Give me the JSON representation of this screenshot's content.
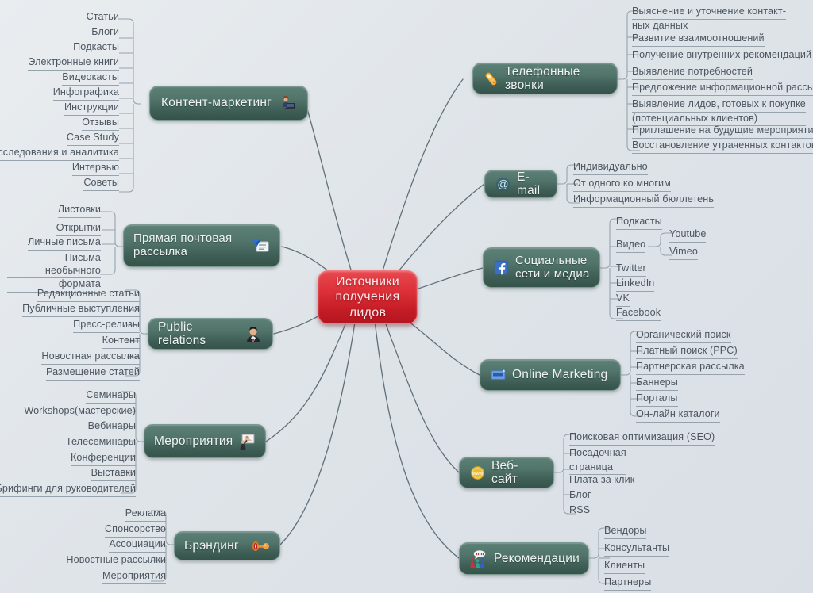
{
  "map": {
    "center": {
      "label": "Источники\nполучения\nлидов",
      "color": "#c81c26"
    },
    "node_color": "#4a6d63",
    "branches": [
      {
        "id": "content-marketing",
        "label": "Контент-маркетинг",
        "icon": "person-laptop-icon",
        "side": "left",
        "children": [
          "Статьи",
          "Блоги",
          "Подкасты",
          "Электронные книги",
          "Видеокасты",
          "Инфографика",
          "Инструкции",
          "Отзывы",
          "Case Study",
          "Исследования и аналитика",
          "Интервью",
          "Советы"
        ]
      },
      {
        "id": "direct-mail",
        "label": "Прямая почтовая\nрассылка",
        "icon": "envelope-letter-icon",
        "side": "left",
        "children": [
          "Листовки",
          "Открытки",
          "Личные письма",
          "Письма необычного формата"
        ]
      },
      {
        "id": "public-relations",
        "label": "Public relations",
        "icon": "businessman-icon",
        "side": "left",
        "children": [
          "Редакционные статьи",
          "Публичные выступления",
          "Пресс-релизы",
          "Контент",
          "Новостная рассылка",
          "Размещение статей"
        ]
      },
      {
        "id": "events",
        "label": "Мероприятия",
        "icon": "presenter-board-icon",
        "side": "left",
        "children": [
          "Семинары",
          "Workshops(мастерские)",
          "Вебинары",
          "Телесеминары",
          "Конференции",
          "Выставки",
          "Брифинги для руководителей"
        ]
      },
      {
        "id": "branding",
        "label": "Брэндинг",
        "icon": "rubber-stamp-icon",
        "side": "left",
        "children": [
          "Реклама",
          "Спонсорство",
          "Ассоциации",
          "Новостные рассылки",
          "Мероприятия"
        ]
      },
      {
        "id": "phone-calls",
        "label": "Телефонные звонки",
        "icon": "mobile-phone-icon",
        "side": "right",
        "children": [
          "Выяснение и уточнение контакт-ных данных",
          "Развитие взаимоотношений",
          "Получение внутренних рекомендаций",
          "Выявление потребностей",
          "Предложение информационной рассылки",
          "Выявление лидов, готовых к покупке (потенциальных клиентов)",
          "Приглашение на будущие мероприятия",
          "Восстановление утраченных контактов"
        ]
      },
      {
        "id": "email",
        "label": "E-mail",
        "icon": "at-sign-icon",
        "side": "right",
        "children": [
          "Индивидуально",
          "От одного ко многим",
          "Информационный бюллетень"
        ]
      },
      {
        "id": "social-media",
        "label": "Социальные\nсети и медиа",
        "icon": "facebook-icon",
        "side": "right",
        "children": [
          "Подкасты",
          "Видео",
          "Twitter",
          "LinkedIn",
          "VK",
          "Facebook"
        ],
        "grandchildren": {
          "parent": "Видео",
          "items": [
            "Youtube",
            "Vimeo"
          ]
        }
      },
      {
        "id": "online-marketing",
        "label": "Online Marketing",
        "icon": "banner-ad-icon",
        "side": "right",
        "children": [
          "Органический поиск",
          "Платный поиск (PPC)",
          "Партнерская рассылка",
          "Баннеры",
          "Порталы",
          "Он-лайн каталоги"
        ]
      },
      {
        "id": "website",
        "label": "Веб-сайт",
        "icon": "www-globe-icon",
        "side": "right",
        "children": [
          "Поисковая оптимизация (SEO)",
          "Посадочная страница",
          "Плата за клик",
          "Блог",
          "RSS"
        ]
      },
      {
        "id": "recommendations",
        "label": "Рекомендации",
        "icon": "people-speech-icon",
        "side": "right",
        "children": [
          "Вендоры",
          "Консультанты",
          "Клиенты",
          "Партнеры"
        ]
      }
    ]
  }
}
